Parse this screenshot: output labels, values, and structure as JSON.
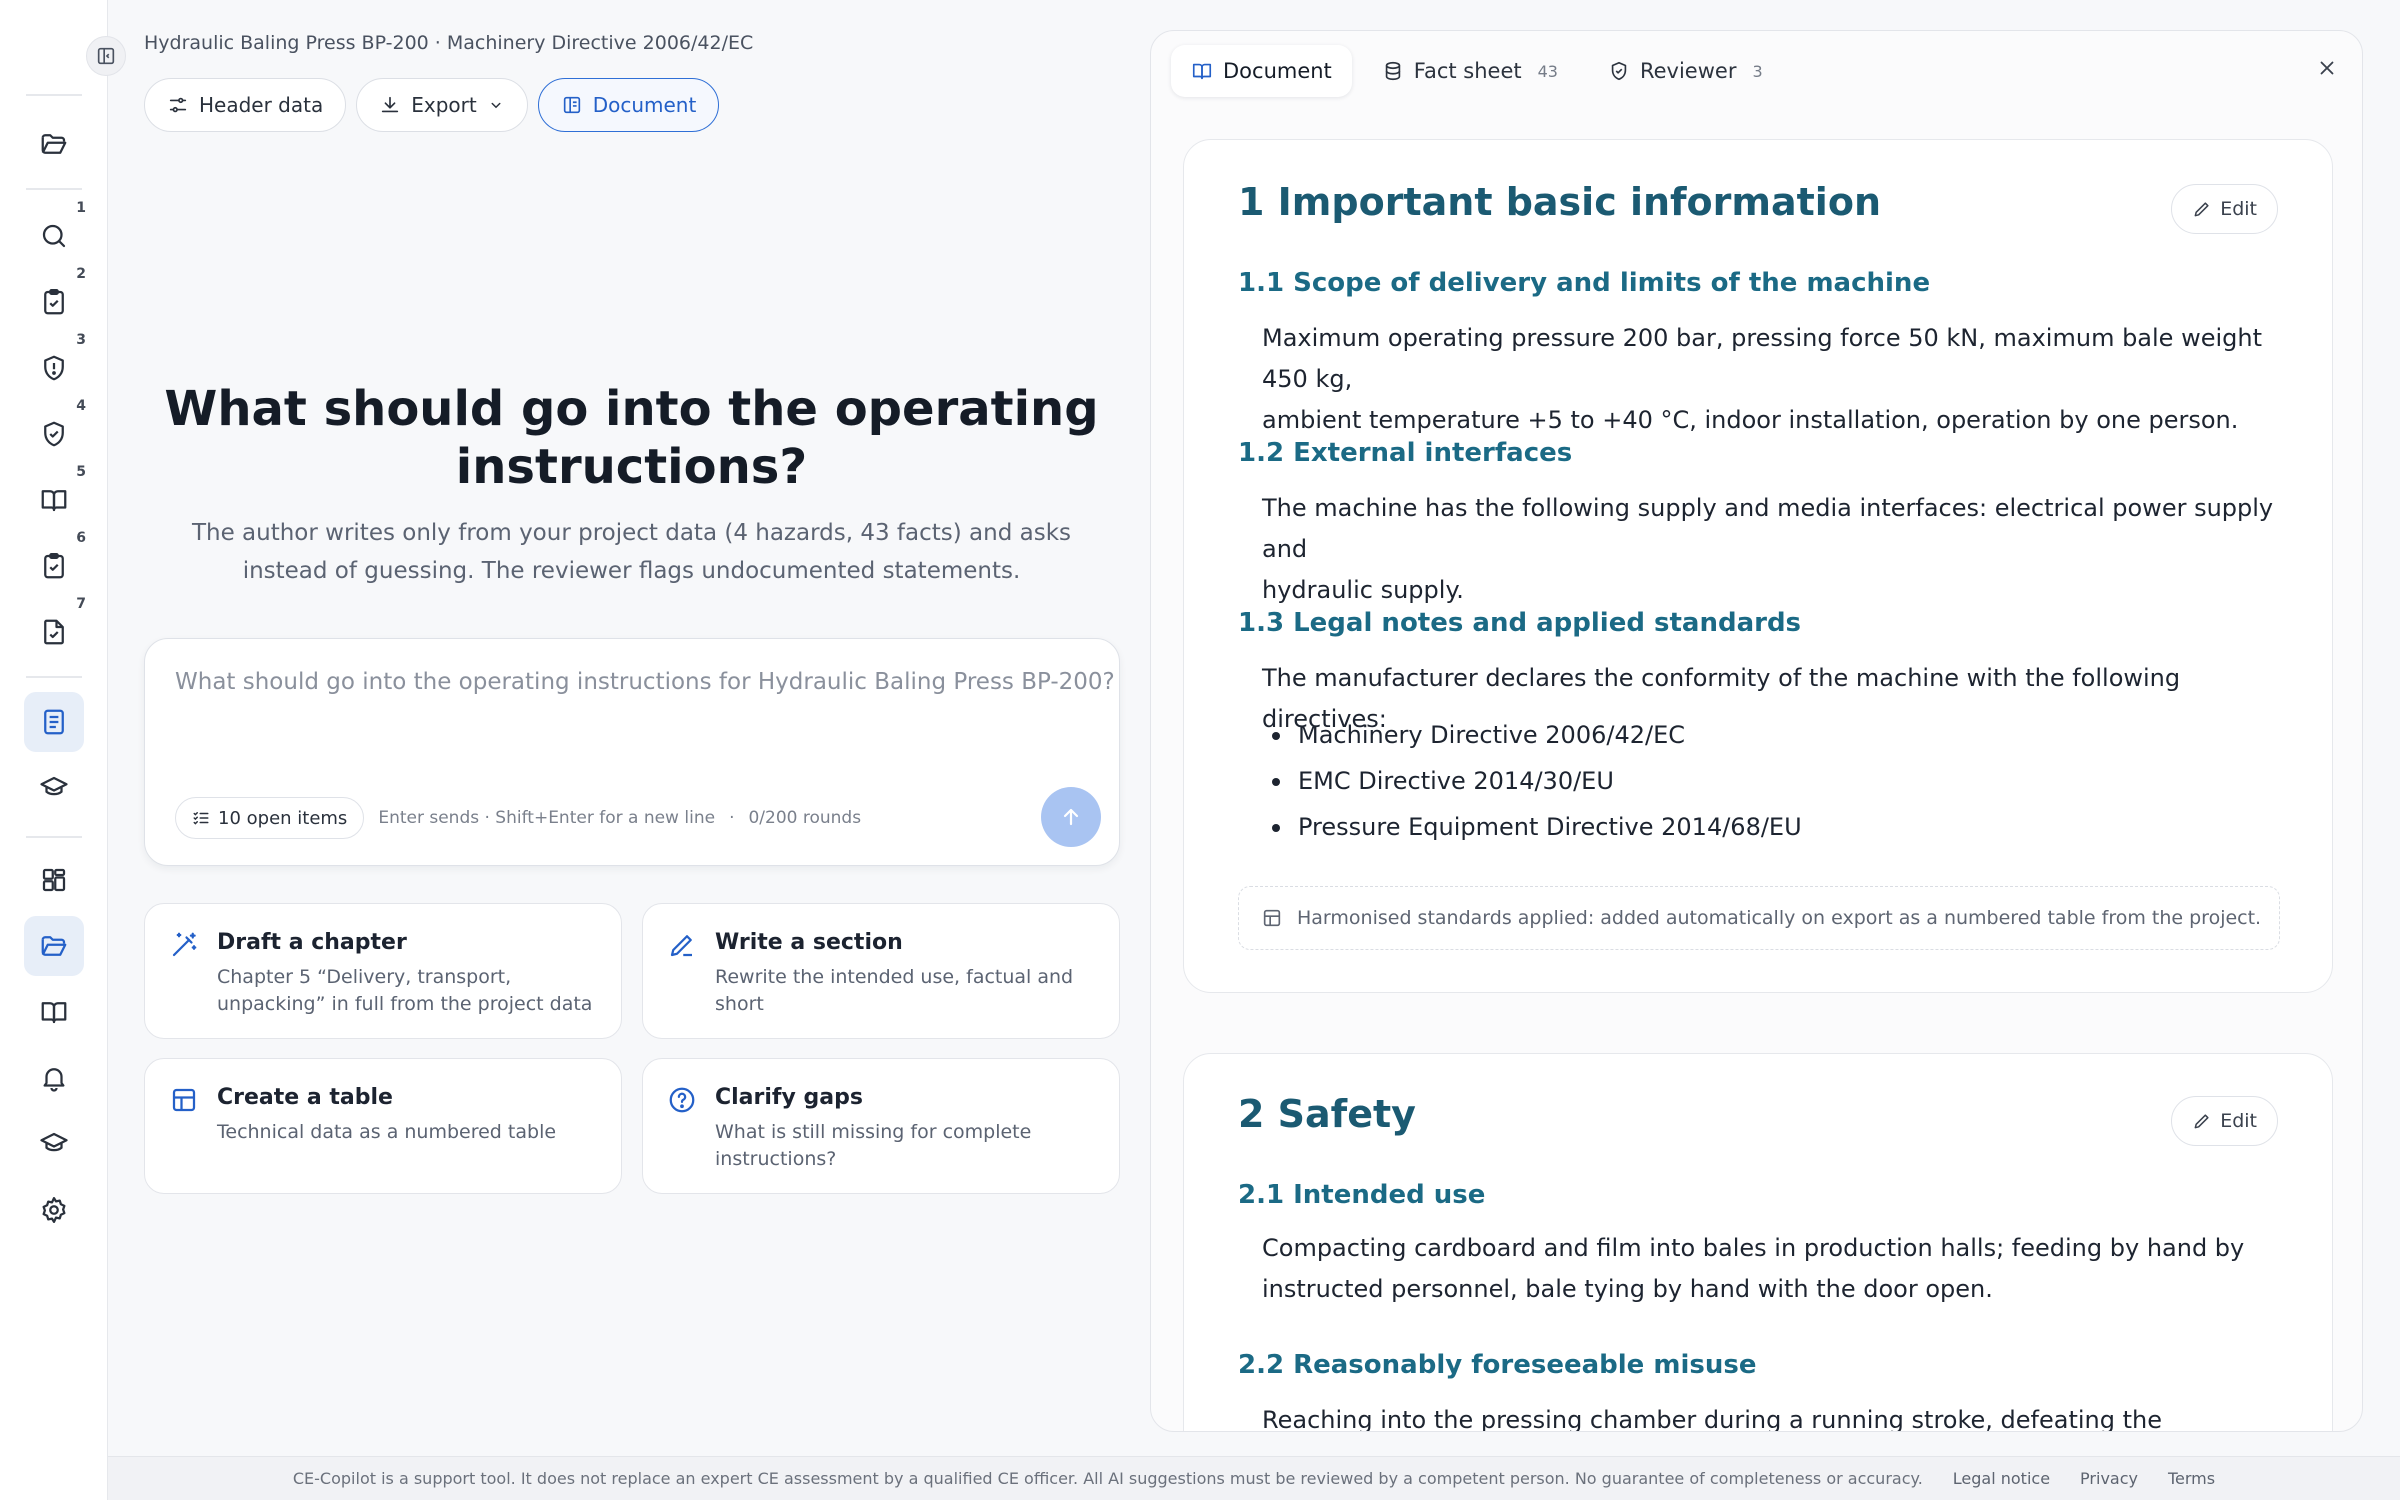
{
  "header": {
    "breadcrumb": "Hydraulic Baling Press BP-200 · Machinery Directive 2006/42/EC",
    "buttons": {
      "header_data": "Header data",
      "export": "Export",
      "document": "Document"
    }
  },
  "rail": {
    "badges": [
      "1",
      "2",
      "3",
      "4",
      "5",
      "6",
      "7"
    ]
  },
  "hero": {
    "title_line1": "What should go into the operating",
    "title_line2": "instructions?",
    "sub_line1": "The author writes only from your project data (4 hazards, 43 facts) and asks",
    "sub_line2": "instead of guessing. The reviewer flags undocumented statements."
  },
  "composer": {
    "placeholder": "What should go into the operating instructions for Hydraulic Baling Press BP-200?",
    "open_items": "10 open items",
    "hint": "Enter sends · Shift+Enter for a new line",
    "dot": "·",
    "rounds": "0/200 rounds"
  },
  "cards": [
    {
      "title": "Draft a chapter",
      "desc_line1": "Chapter 5 “Delivery, transport,",
      "desc_line2": "unpacking” in full from the project data"
    },
    {
      "title": "Write a section",
      "desc_line1": "Rewrite the intended use, factual and",
      "desc_line2": "short"
    },
    {
      "title": "Create a table",
      "desc_line1": "Technical data as a numbered table",
      "desc_line2": ""
    },
    {
      "title": "Clarify gaps",
      "desc_line1": "What is still missing for complete",
      "desc_line2": "instructions?"
    }
  ],
  "panel": {
    "tabs": [
      {
        "label": "Document",
        "count": ""
      },
      {
        "label": "Fact sheet",
        "count": "43"
      },
      {
        "label": "Reviewer",
        "count": "3"
      }
    ]
  },
  "doc": {
    "edit_label": "Edit",
    "s1": {
      "title": "1 Important basic information",
      "h11": "1.1 Scope of delivery and limits of the machine",
      "p11_line1": "Maximum operating pressure 200 bar, pressing force 50 kN, maximum bale weight 450 kg,",
      "p11_line2": "ambient temperature +5 to +40 °C, indoor installation, operation by one person.",
      "h12": "1.2 External interfaces",
      "p12_line1": "The machine has the following supply and media interfaces: electrical power supply and",
      "p12_line2": "hydraulic supply.",
      "h13": "1.3 Legal notes and applied standards",
      "p13": "The manufacturer declares the conformity of the machine with the following directives:",
      "directives": [
        "Machinery Directive 2006/42/EC",
        "EMC Directive 2014/30/EU",
        "Pressure Equipment Directive 2014/68/EU"
      ],
      "note": "Harmonised standards applied: added automatically on export as a numbered table from the project."
    },
    "s2": {
      "title": "2 Safety",
      "h21": "2.1 Intended use",
      "p21_line1": "Compacting cardboard and film into bales in production halls; feeding by hand by",
      "p21_line2": "instructed personnel, bale tying by hand with the door open.",
      "h22": "2.2 Reasonably foreseeable misuse",
      "p22": "Reaching into the pressing chamber during a running stroke, defeating the interlocking feed"
    }
  },
  "footer": {
    "disclaimer": "CE-Copilot is a support tool. It does not replace an expert CE assessment by a qualified CE officer. All AI suggestions must be reviewed by a competent person. No guarantee of completeness or accuracy.",
    "links": [
      "Legal notice",
      "Privacy",
      "Terms"
    ]
  },
  "colors": {
    "accent": "#2460c8",
    "heading": "#1b5a72",
    "send_disabled": "#a9c4f2"
  }
}
